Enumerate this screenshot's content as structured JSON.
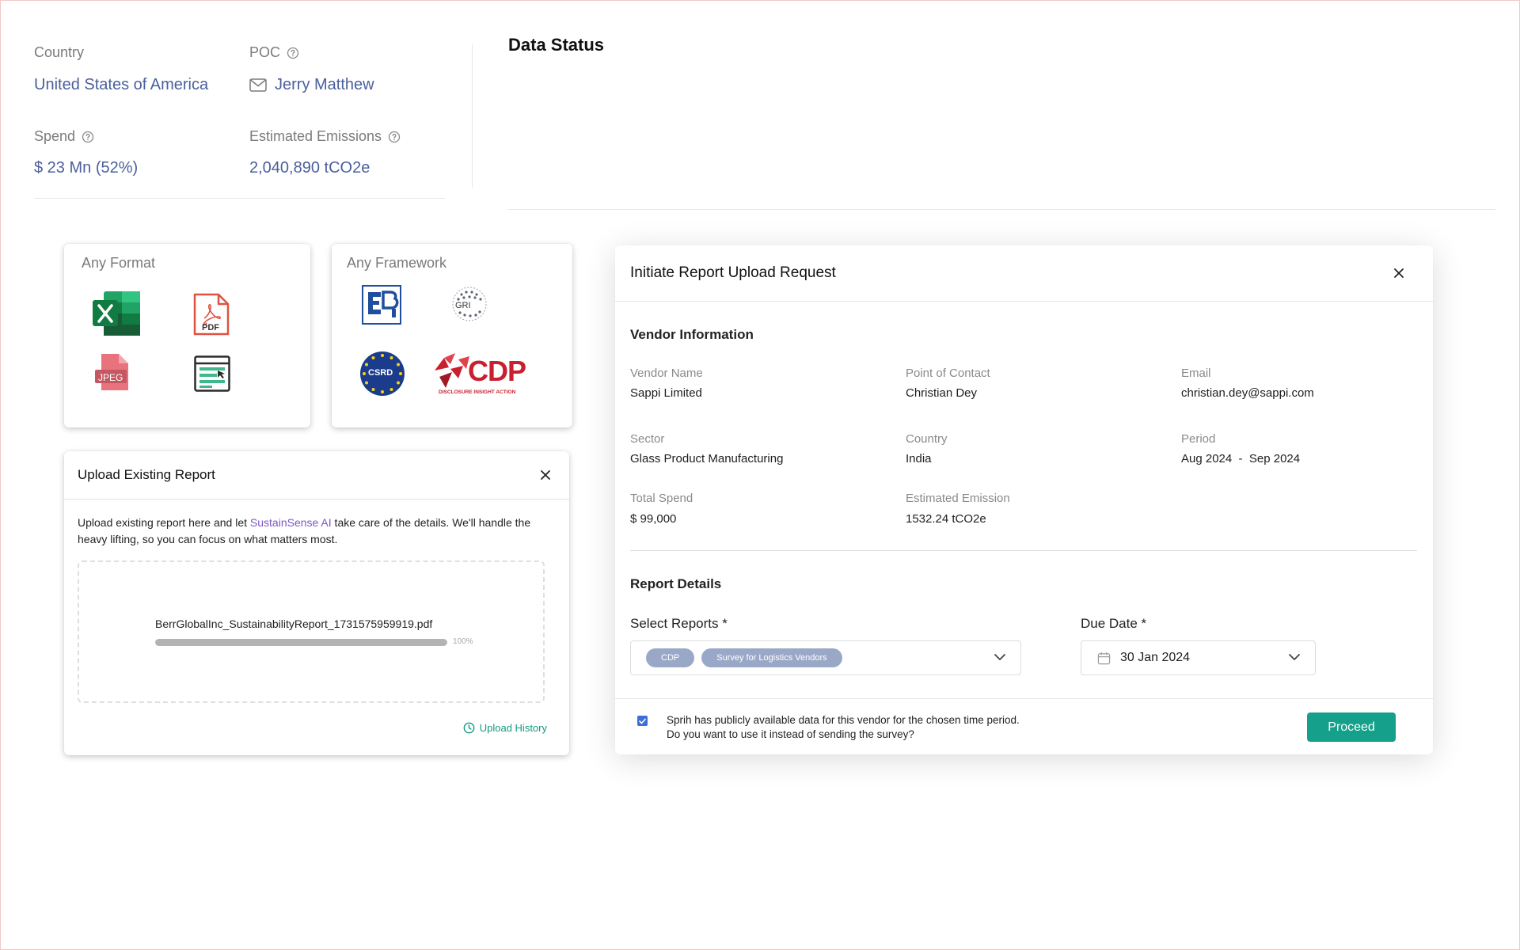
{
  "summary": {
    "country_label": "Country",
    "country_value": "United States of America",
    "poc_label": "POC",
    "poc_value": "Jerry Matthew",
    "spend_label": "Spend",
    "spend_value": "$ 23 Mn (52%)",
    "emissions_label": "Estimated Emissions",
    "emissions_value": "2,040,890 tCO2e"
  },
  "data_status": {
    "title": "Data Status"
  },
  "any_format": {
    "title": "Any Format",
    "icons": [
      "excel-icon",
      "pdf-icon",
      "jpeg-icon",
      "web-document-icon"
    ],
    "pdf_text": "PDF",
    "jpeg_text": "JPEG"
  },
  "any_framework": {
    "title": "Any Framework",
    "logos": [
      "sebi-logo",
      "gri-logo",
      "csrd-logo",
      "cdp-logo"
    ],
    "csrd_text": "CSRD",
    "cdp_text": "CDP",
    "cdp_tagline": "DISCLOSURE INSIGHT ACTION",
    "gri_text": "GRI"
  },
  "upload_report": {
    "title": "Upload Existing Report",
    "desc_before": "Upload existing report here and let ",
    "desc_brand": "SustainSense AI",
    "desc_after": " take care of the details. We'll handle the heavy lifting, so you can focus on what matters most.",
    "file_name": "BerrGlobalInc_SustainabilityReport_1731575959919.pdf",
    "progress": 100,
    "progress_label": "100%",
    "history_label": "Upload History"
  },
  "modal": {
    "title": "Initiate Report Upload Request",
    "vendor_section": "Vendor Information",
    "vendor": {
      "vendor_name_label": "Vendor Name",
      "vendor_name": "Sappi Limited",
      "poc_label": "Point of Contact",
      "poc": "Christian Dey",
      "email_label": "Email",
      "email": "christian.dey@sappi.com",
      "sector_label": "Sector",
      "sector": "Glass Product Manufacturing",
      "country_label": "Country",
      "country": "India",
      "period_label": "Period",
      "period": "Aug 2024  -  Sep 2024",
      "total_spend_label": "Total Spend",
      "total_spend": "$ 99,000",
      "est_emission_label": "Estimated Emission",
      "est_emission": "1532.24 tCO2e"
    },
    "report_section": "Report Details",
    "select_reports_label": "Select Reports *",
    "selected_reports": [
      "CDP",
      "Survey for Logistics Vendors"
    ],
    "due_date_label": "Due Date *",
    "due_date": "30 Jan 2024",
    "footer_line1": "Sprih has publicly available data for this vendor for the chosen time period.",
    "footer_line2": "Do you want to use it instead of sending the survey?",
    "checkbox_checked": true,
    "proceed_label": "Proceed"
  },
  "colors": {
    "summary_value": "#4a5f9c",
    "accent_teal": "#14a08a",
    "chip": "#9aa8c8",
    "brand_purple": "#7e57c2"
  }
}
